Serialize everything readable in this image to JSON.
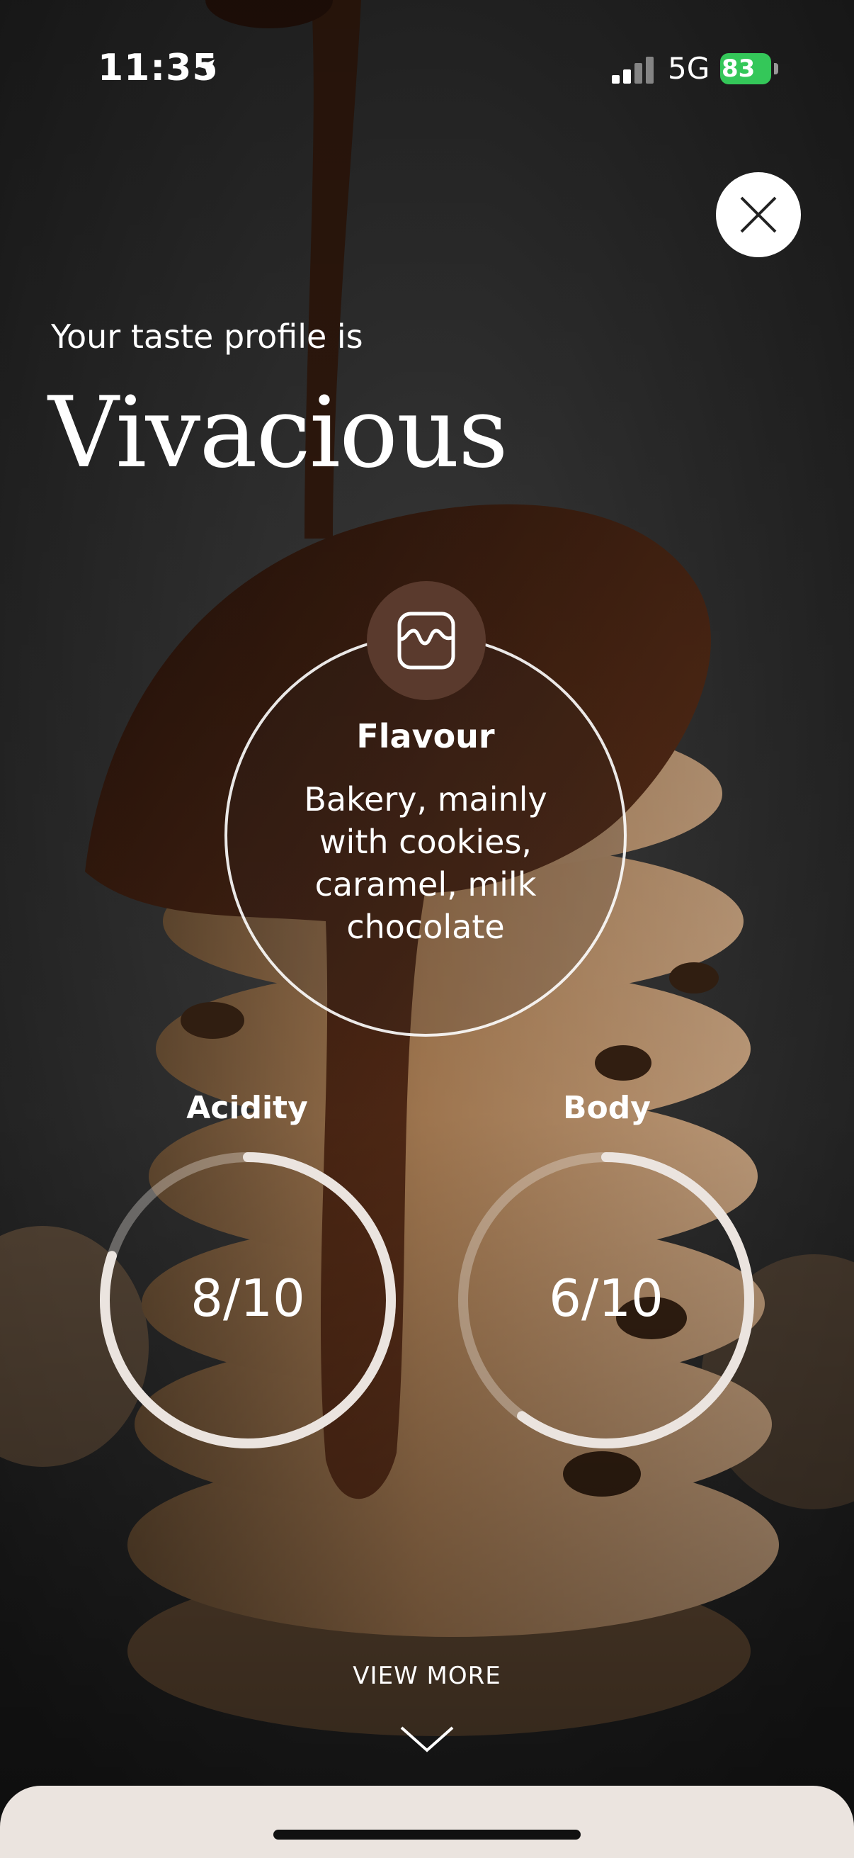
{
  "status_bar": {
    "time": "11:35",
    "network": "5G",
    "battery": "83"
  },
  "header": {
    "subtitle": "Your taste profile is",
    "profile_name": "Vivacious"
  },
  "flavour": {
    "title": "Flavour",
    "description": "Bakery, mainly with cookies, caramel, milk chocolate"
  },
  "metrics": [
    {
      "label": "Acidity",
      "value_text": "8/10",
      "value": 8,
      "max": 10
    },
    {
      "label": "Body",
      "value_text": "6/10",
      "value": 6,
      "max": 10
    }
  ],
  "footer": {
    "view_more": "VIEW MORE"
  },
  "colors": {
    "accent_brown": "#5a3a2d",
    "ring_light": "#ebe4df",
    "battery_green": "#34c759"
  },
  "icons": [
    "location-arrow-icon",
    "signal-icon",
    "battery-icon",
    "close-icon",
    "flavour-icon",
    "chevron-down-icon"
  ]
}
